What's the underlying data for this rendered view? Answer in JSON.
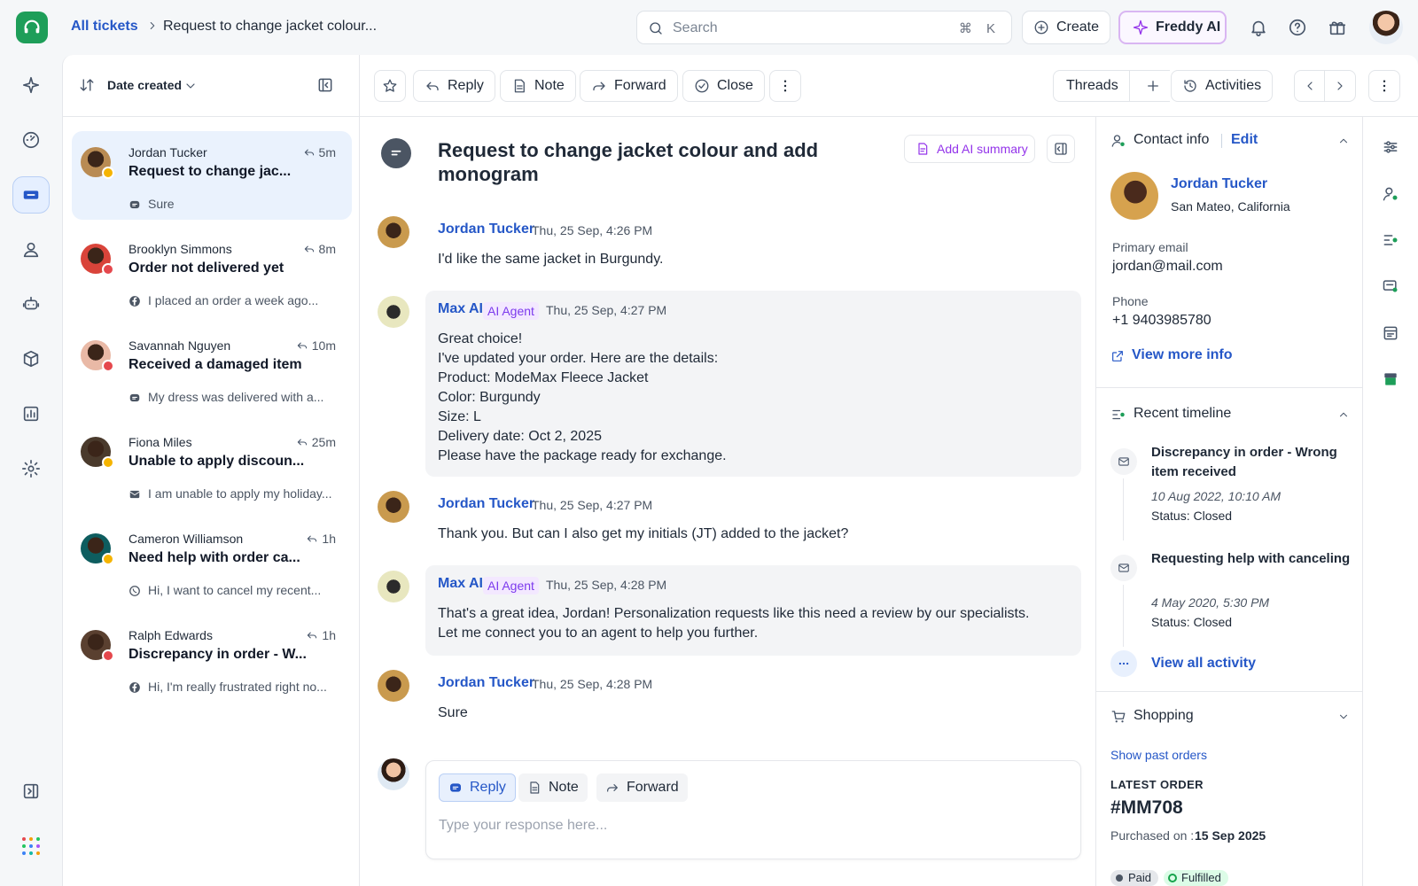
{
  "breadcrumb": {
    "link": "All tickets",
    "current": "Request to change jacket colour..."
  },
  "search": {
    "placeholder": "Search",
    "shortcut": "⌘ K"
  },
  "header": {
    "create_label": "Create",
    "freddy_label": "Freddy AI"
  },
  "list": {
    "sort_label": "Date created",
    "tickets": [
      {
        "name": "Jordan Tucker",
        "time": "5m",
        "subject": "Request to change jac...",
        "preview": "Sure",
        "channel": "chat-icon",
        "emoji_color": "#f5b400",
        "avatar_color": "#b98b53"
      },
      {
        "name": "Brooklyn Simmons",
        "time": "8m",
        "subject": "Order not delivered yet",
        "preview": "I placed an order a week ago...",
        "channel": "facebook-icon",
        "emoji_color": "#e5484d",
        "avatar_color": "#d9443a"
      },
      {
        "name": "Savannah Nguyen",
        "time": "10m",
        "subject": "Received a damaged item",
        "preview": "My dress was delivered with a...",
        "channel": "chat-icon",
        "emoji_color": "#e5484d",
        "avatar_color": "#e9b9a6"
      },
      {
        "name": "Fiona Miles",
        "time": "25m",
        "subject": "Unable to apply discoun...",
        "preview": "I am unable to apply my holiday...",
        "channel": "email-icon",
        "emoji_color": "#f5b400",
        "avatar_color": "#4a3a2c"
      },
      {
        "name": "Cameron Williamson",
        "time": "1h",
        "subject": "Need help with order ca...",
        "preview": "Hi, I want to cancel my recent...",
        "channel": "whatsapp-icon",
        "emoji_color": "#f5b400",
        "avatar_color": "#0e5d5f"
      },
      {
        "name": "Ralph Edwards",
        "time": "1h",
        "subject": "Discrepancy in order - W...",
        "preview": "Hi, I'm really frustrated right no...",
        "channel": "facebook-icon",
        "emoji_color": "#e5484d",
        "avatar_color": "#5a4030"
      }
    ]
  },
  "toolbar": {
    "reply": "Reply",
    "note": "Note",
    "forward": "Forward",
    "close": "Close",
    "threads": "Threads",
    "activities": "Activities"
  },
  "conversation": {
    "title": "Request to change jacket colour and add monogram",
    "ai_summary": "Add AI summary",
    "messages": [
      {
        "author": "Jordan Tucker",
        "time": "Thu, 25 Sep, 4:26 PM",
        "text": "I'd like the same jacket in Burgundy."
      },
      {
        "author": "Max AI",
        "tag": "AI Agent",
        "time": "Thu, 25 Sep, 4:27 PM",
        "text": "Great choice!\nI've updated your order. Here are the details:\nProduct: ModeMax Fleece Jacket\nColor: Burgundy\nSize: L\nDelivery date: Oct 2, 2025\nPlease have the package ready for exchange."
      },
      {
        "author": "Jordan Tucker",
        "time": "Thu, 25 Sep, 4:27 PM",
        "text": "Thank you. But can I also get my initials (JT) added to the jacket?"
      },
      {
        "author": "Max AI",
        "tag": "AI Agent",
        "time": "Thu, 25 Sep, 4:28 PM",
        "text": "That's a great idea, Jordan! Personalization requests like this need a review by our specialists.\nLet me connect you to an agent to help you further."
      },
      {
        "author": "Jordan Tucker",
        "time": "Thu, 25 Sep, 4:28 PM",
        "text": "Sure"
      }
    ],
    "composer": {
      "reply": "Reply",
      "note": "Note",
      "forward": "Forward",
      "placeholder": "Type your response here..."
    }
  },
  "contact": {
    "section_title": "Contact info",
    "edit": "Edit",
    "name": "Jordan Tucker",
    "location": "San Mateo, California",
    "email_label": "Primary email",
    "email": "jordan@mail.com",
    "phone_label": "Phone",
    "phone": "+1 9403985780",
    "view_more": "View more info"
  },
  "timeline": {
    "title": "Recent timeline",
    "items": [
      {
        "title": "Discrepancy in order - Wrong item received",
        "date": "10 Aug 2022, 10:10 AM",
        "status": "Status: Closed"
      },
      {
        "title": "Requesting help with canceling my order, as I rec...",
        "date": "4 May 2020, 5:30 PM",
        "status": "Status: Closed"
      }
    ],
    "view_all": "View all activity"
  },
  "shopping": {
    "title": "Shopping",
    "past_orders": "Show past orders",
    "latest_label": "LATEST ORDER",
    "order_id": "#MM708",
    "purchased_label": "Purchased on :",
    "purchased_date": "15 Sep 2025",
    "badges": [
      "Paid",
      "Fulfilled"
    ]
  },
  "colors": {
    "accent": "#2557c7",
    "brand": "#1e9e59",
    "ai": "#9333ea"
  }
}
